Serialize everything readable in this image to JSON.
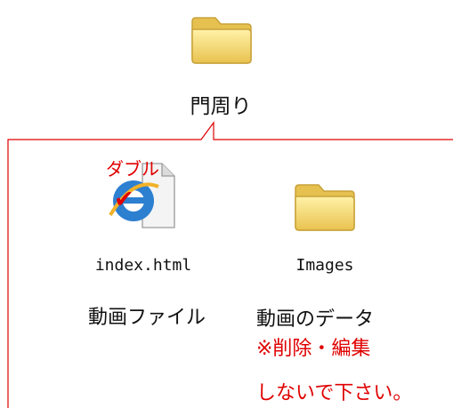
{
  "root": {
    "label": "門周り",
    "icon": "folder-icon"
  },
  "file": {
    "icon": "internet-explorer-icon",
    "name": "index.html",
    "description": "動画ファイル",
    "annotation": "ダブル",
    "check_mark": "✔"
  },
  "subfolder": {
    "icon": "folder-icon",
    "name": "Images",
    "description": "動画のデータ",
    "warning_line1": "※削除・編集",
    "warning_line2": "しないで下さい。"
  },
  "colors": {
    "connector": "#e00000",
    "annotation": "#e00000",
    "folder_fill": "#f6d86b",
    "folder_stroke": "#c8a23a"
  }
}
